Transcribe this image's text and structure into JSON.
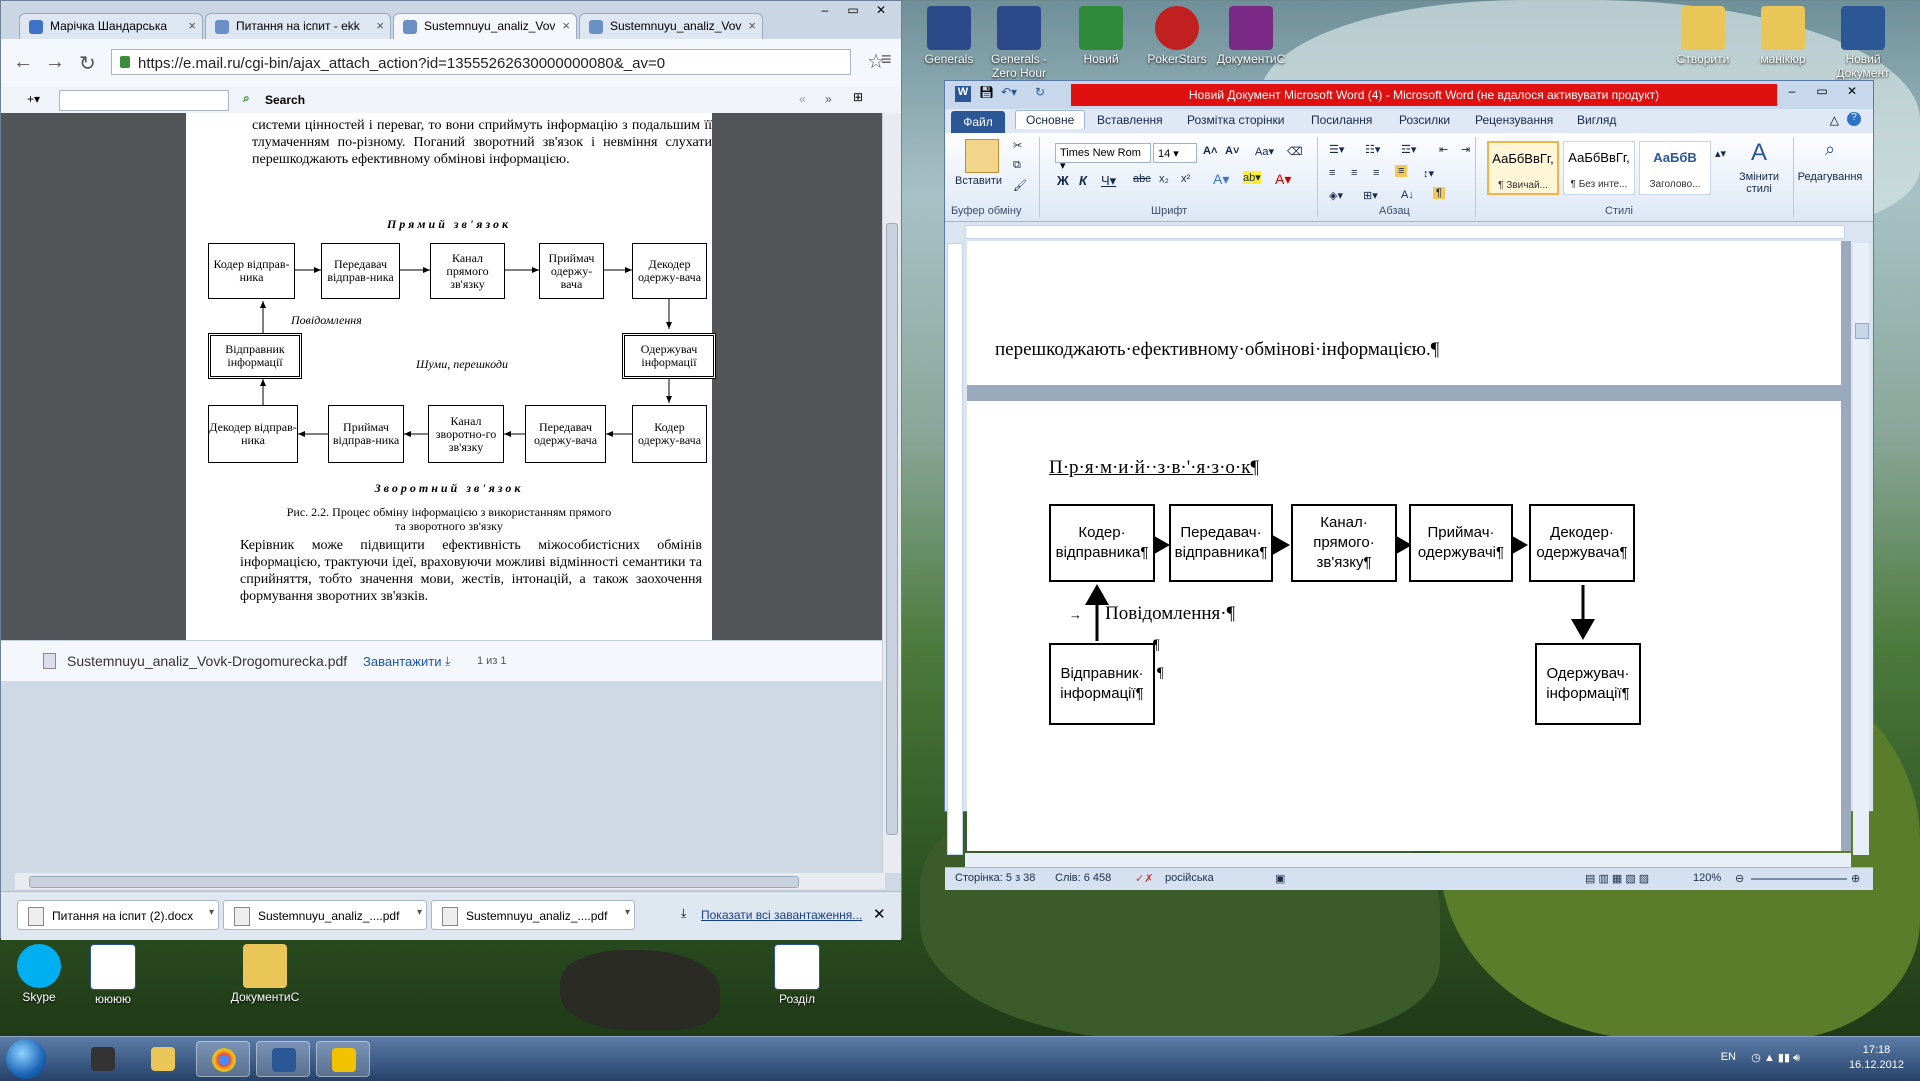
{
  "chrome": {
    "tabs": [
      "Марічка Шандарська",
      "Питання на іспит - ekk",
      "Sustemnuyu_analiz_Vov",
      "Sustemnuyu_analiz_Vov"
    ],
    "url": "https://e.mail.ru/cgi-bin/ajax_attach_action?id=13555262630000000080&_av=0",
    "search_label": "Search",
    "pdf": {
      "para1": "системи цінностей і переваг, то вони сприймуть інформацію з подальшим її тлумаченням по-різному. Поганий зворотний зв'язок і невміння слухати перешкоджають ефективному обмінові інформацією.",
      "title_direct": "Прямий зв'язок",
      "title_reverse": "Зворотний зв'язок",
      "row1": [
        "Кодер відправ-ника",
        "Передавач відправ-ника",
        "Канал прямого зв'язку",
        "Приймач одержу-вача",
        "Декодер одержу-вача"
      ],
      "sender_info": "Відправник інформації",
      "receiver_info": "Одержувач інформації",
      "message": "Повідомлення",
      "noise": "Шуми, перешкоди",
      "row2": [
        "Декодер відправ-ника",
        "Приймач відправ-ника",
        "Канал зворотно-го зв'язку",
        "Передавач одержу-вача",
        "Кодер одержу-вача"
      ],
      "caption1": "Рис. 2.2. Процес обміну інформацією з використанням прямого",
      "caption2": "та зворотного зв'язку",
      "para2": "Керівник може підвищити ефективність міжособистісних обмінів інформацією, трактуючи ідеї, враховуючи можливі відмінності семантики та сприйняття, тобто значення мови, жестів, інтонацій, а також заохочення формування зворотних зв'язків."
    },
    "pdf_filename": "Sustemnuyu_analiz_Vovk-Drogomurecka.pdf",
    "download_link": "Завантажити",
    "page_count": "1 из 1",
    "downloads": [
      "Питання на іспит (2).docx",
      "Sustemnuyu_analiz_....pdf",
      "Sustemnuyu_analiz_....pdf"
    ],
    "show_all": "Показати всі завантаження..."
  },
  "word": {
    "title": "Новий Документ Microsoft Word (4)  -  Microsoft Word (не вдалося активувати продукт)",
    "tabs": [
      "Файл",
      "Основне",
      "Вставлення",
      "Розмітка сторінки",
      "Посилання",
      "Розсилки",
      "Рецензування",
      "Вигляд"
    ],
    "paste": "Вставити",
    "font_name": "Times New Rom",
    "font_size": "14",
    "styles": [
      {
        "sample": "АаБбВвГг,",
        "name": "¶ Звичай..."
      },
      {
        "sample": "АаБбВвГг,",
        "name": "¶ Без инте..."
      },
      {
        "sample": "АаБбВ",
        "name": "Заголово..."
      }
    ],
    "change_styles": "Змінити стилі",
    "editing": "Редагування",
    "groups": [
      "Буфер обміну",
      "Шрифт",
      "Абзац",
      "Стилі"
    ],
    "page1_text": "перешкоджають·ефективному·обмінові·інформацією.¶",
    "heading": "П·р·я·м·и·й··з·в·'·я·з·о·к¶",
    "row1": [
      "Кодер· відправника¶",
      "Передавач· відправника¶",
      "Канал· прямого· зв'язку¶",
      "Приймач· одержувачі¶",
      "Декодер· одержувача¶"
    ],
    "message": "Повідомлення·¶",
    "tab_mark": "→",
    "pilcrow": "¶",
    "sender_info": "Відправник· інформації¶",
    "receiver_info": "Одержувач· інформації¶",
    "status": {
      "page": "Сторінка: 5 з 38",
      "words": "Слів: 6 458",
      "lang": "російська",
      "zoom": "120%"
    }
  },
  "desktop": {
    "icons_top": [
      "Generals",
      "Generals - Zero Hour",
      "Новий",
      "PokerStars",
      "ДокументиС",
      "Створити",
      "манікюр",
      "Новий Документ"
    ],
    "icons_left": [
      "Skype",
      "юююю",
      "ДокументиС",
      "Розділ"
    ]
  },
  "taskbar": {
    "lang": "EN",
    "time": "17:18",
    "date": "16.12.2012"
  }
}
